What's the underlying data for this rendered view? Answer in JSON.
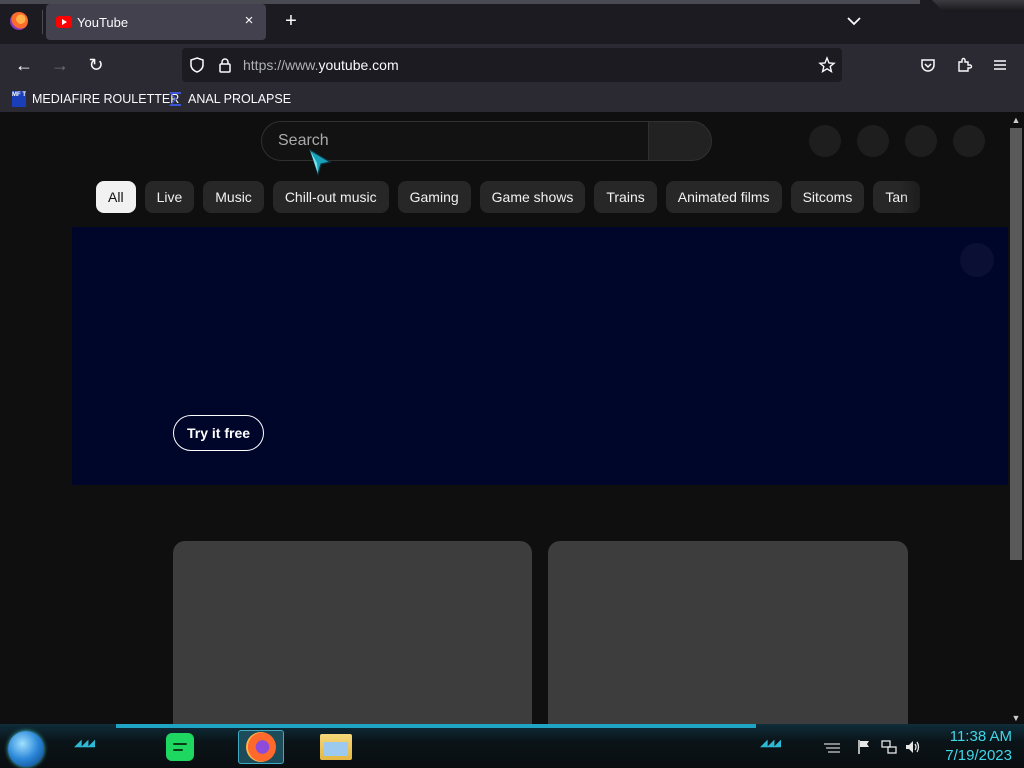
{
  "browser": {
    "tab": {
      "title": "YouTube",
      "close_label": "×"
    },
    "new_tab_label": "+",
    "nav": {
      "back": "←",
      "forward": "→",
      "reload": "↻"
    },
    "url_prefix": "https://www.",
    "url_domain": "youtube.com",
    "bookmarks": [
      {
        "label": "MEDIAFIRE ROULETTER",
        "icon": "mediafire-icon",
        "icon_text": "MF T"
      },
      {
        "label": "ANAL PROLAPSE",
        "icon": "sigma-icon"
      }
    ]
  },
  "youtube": {
    "search_placeholder": "Search",
    "chips": [
      "All",
      "Live",
      "Music",
      "Chill-out music",
      "Gaming",
      "Game shows",
      "Trains",
      "Animated films",
      "Sitcoms",
      "Tan"
    ],
    "active_chip": "All",
    "banner": {
      "cta_label": "Try it free",
      "background": "#00052a"
    }
  },
  "taskbar": {
    "apps": [
      "spotify-icon",
      "firefox-icon",
      "file-explorer-icon"
    ],
    "active_app": "firefox-icon",
    "clock": {
      "time": "11:38 AM",
      "date": "7/19/2023"
    }
  },
  "colors": {
    "page_bg": "#0f0f0f",
    "chip_bg": "#272727",
    "chip_active_bg": "#f1f1f1",
    "card_placeholder": "#3d3d3d",
    "clock_color": "#3fd6e8"
  }
}
